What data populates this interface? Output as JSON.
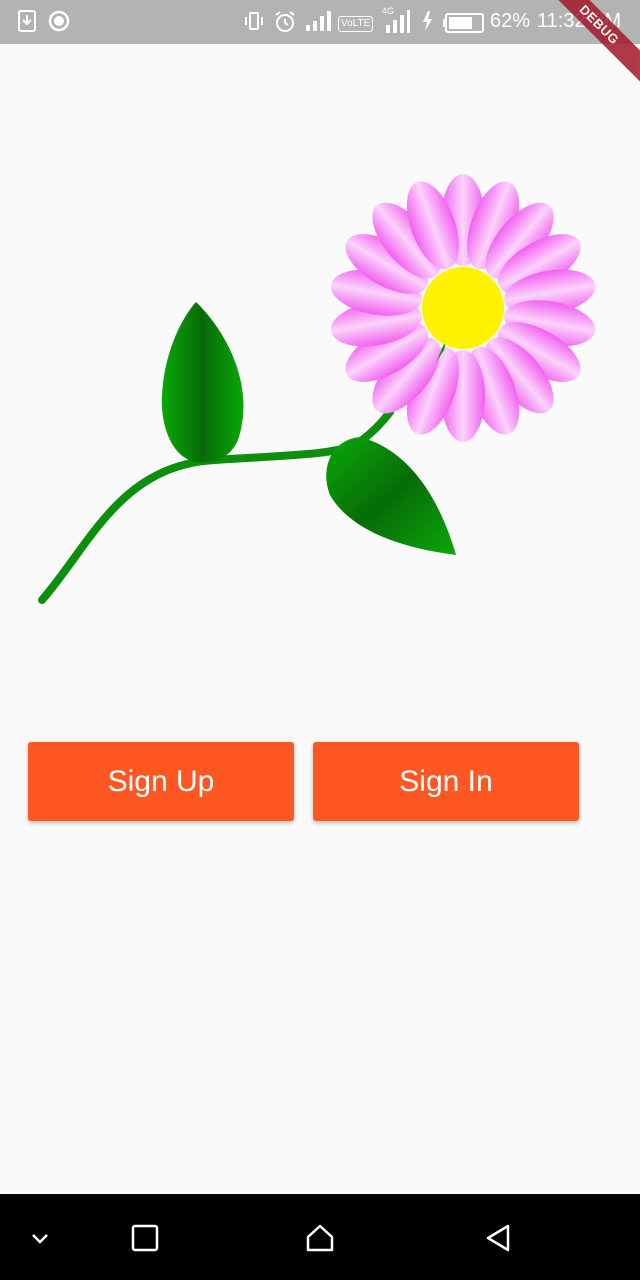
{
  "status_bar": {
    "battery_percent": "62%",
    "time": "11:32 PM",
    "network_label": "VoLTE",
    "network_gen": "4G",
    "debug_label": "DEBUG"
  },
  "buttons": {
    "sign_up": "Sign Up",
    "sign_in": "Sign In"
  },
  "colors": {
    "button": "#ff5722",
    "petal": "#f26cf2",
    "flower_center": "#fff200",
    "leaf": "#0a9a0a",
    "stem": "#0d8f0d"
  },
  "icons": {
    "nav": [
      "chevron-down-icon",
      "recent-apps-icon",
      "home-icon",
      "back-icon"
    ]
  }
}
